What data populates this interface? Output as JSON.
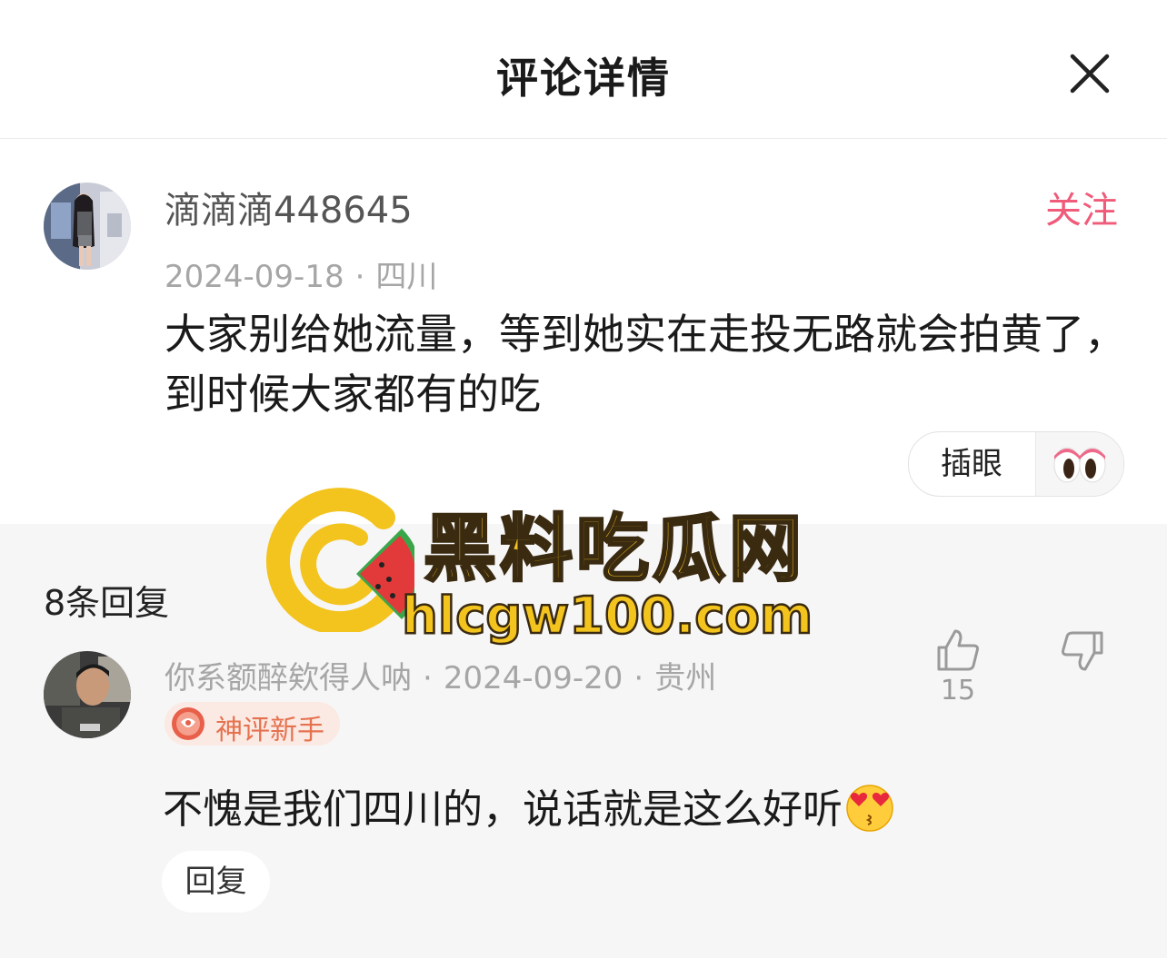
{
  "header": {
    "title": "评论详情"
  },
  "main_comment": {
    "username": "滴滴滴448645",
    "follow_label": "关注",
    "date": "2024-09-18",
    "location": "四川",
    "separator": "·",
    "text": "大家别给她流量，等到她实在走投无路就会拍黄了，到时候大家都有的吃",
    "reaction_label": "插眼",
    "reaction_icon": "eyes-icon"
  },
  "replies_section": {
    "count_label": "8条回复",
    "reply": {
      "username": "你系额醉欸得人呐",
      "separator": "·",
      "date": "2024-09-20",
      "location": "贵州",
      "badge": "神评新手",
      "text": "不愧是我们四川的，说话就是这么好听",
      "emoji": "smiling-face-with-heart-eyes-kiss",
      "reply_label": "回复",
      "like_count": "15"
    }
  },
  "watermark": {
    "title": "黑料吃瓜网",
    "url": "hlcgw100.com"
  },
  "colors": {
    "accent": "#ef5b79",
    "badge_text": "#e5724f",
    "badge_bg": "#fbe9e3",
    "meta": "#a6a6a6",
    "section_bg": "#f6f6f6",
    "watermark_yellow": "#f3c31e"
  }
}
